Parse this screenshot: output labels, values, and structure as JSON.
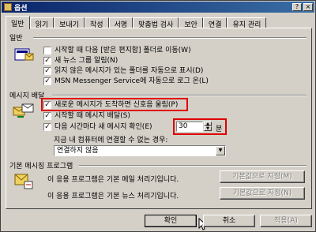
{
  "window": {
    "title": "옵션",
    "help_label": "?",
    "close_label": "×"
  },
  "tabs": [
    "일반",
    "읽기",
    "보내기",
    "작성",
    "서명",
    "맞춤법 검사",
    "보안",
    "연결",
    "유지 관리"
  ],
  "general": {
    "label": "일반",
    "items": [
      {
        "label": "시작할 때 다음 [받은 편지함] 폴더로 이동(W)",
        "checked": false
      },
      {
        "label": "새 뉴스 그룹 알림(N)",
        "checked": true
      },
      {
        "label": "읽지 않은 메시지가 있는 폴더를 자동으로 표시(D)",
        "checked": true
      },
      {
        "label": "MSN Messenger Service에 자동으로 로그 온(L)",
        "checked": true
      }
    ]
  },
  "arrive": {
    "label": "메시지 배달",
    "items": [
      {
        "label": "새로운 메시지가 도착하면 신호음 울림(P)",
        "checked": true
      },
      {
        "label": "시작할 때 메시지 배달(S)",
        "checked": true
      },
      {
        "label": "다음 시간마다 새 메시지 확인(E)",
        "checked": true
      }
    ],
    "interval_value": "30",
    "interval_unit": "분",
    "connect_prompt": "지금 내 컴퓨터에 연결할 수 없는 경우:",
    "connect_option": "연결하지 않음"
  },
  "default_programs": {
    "label": "기본 메시징 프로그램",
    "mail_text": "이 응용 프로그램은 기본 메일 처리기입니다.",
    "mail_button": "기본값으로 지정(M)",
    "news_text": "이 응용 프로그램은 기본 뉴스 처리기입니다.",
    "news_button": "기본값으로 지정(N)"
  },
  "footer": {
    "ok": "확인",
    "cancel": "취소",
    "apply": "적용(A)"
  }
}
